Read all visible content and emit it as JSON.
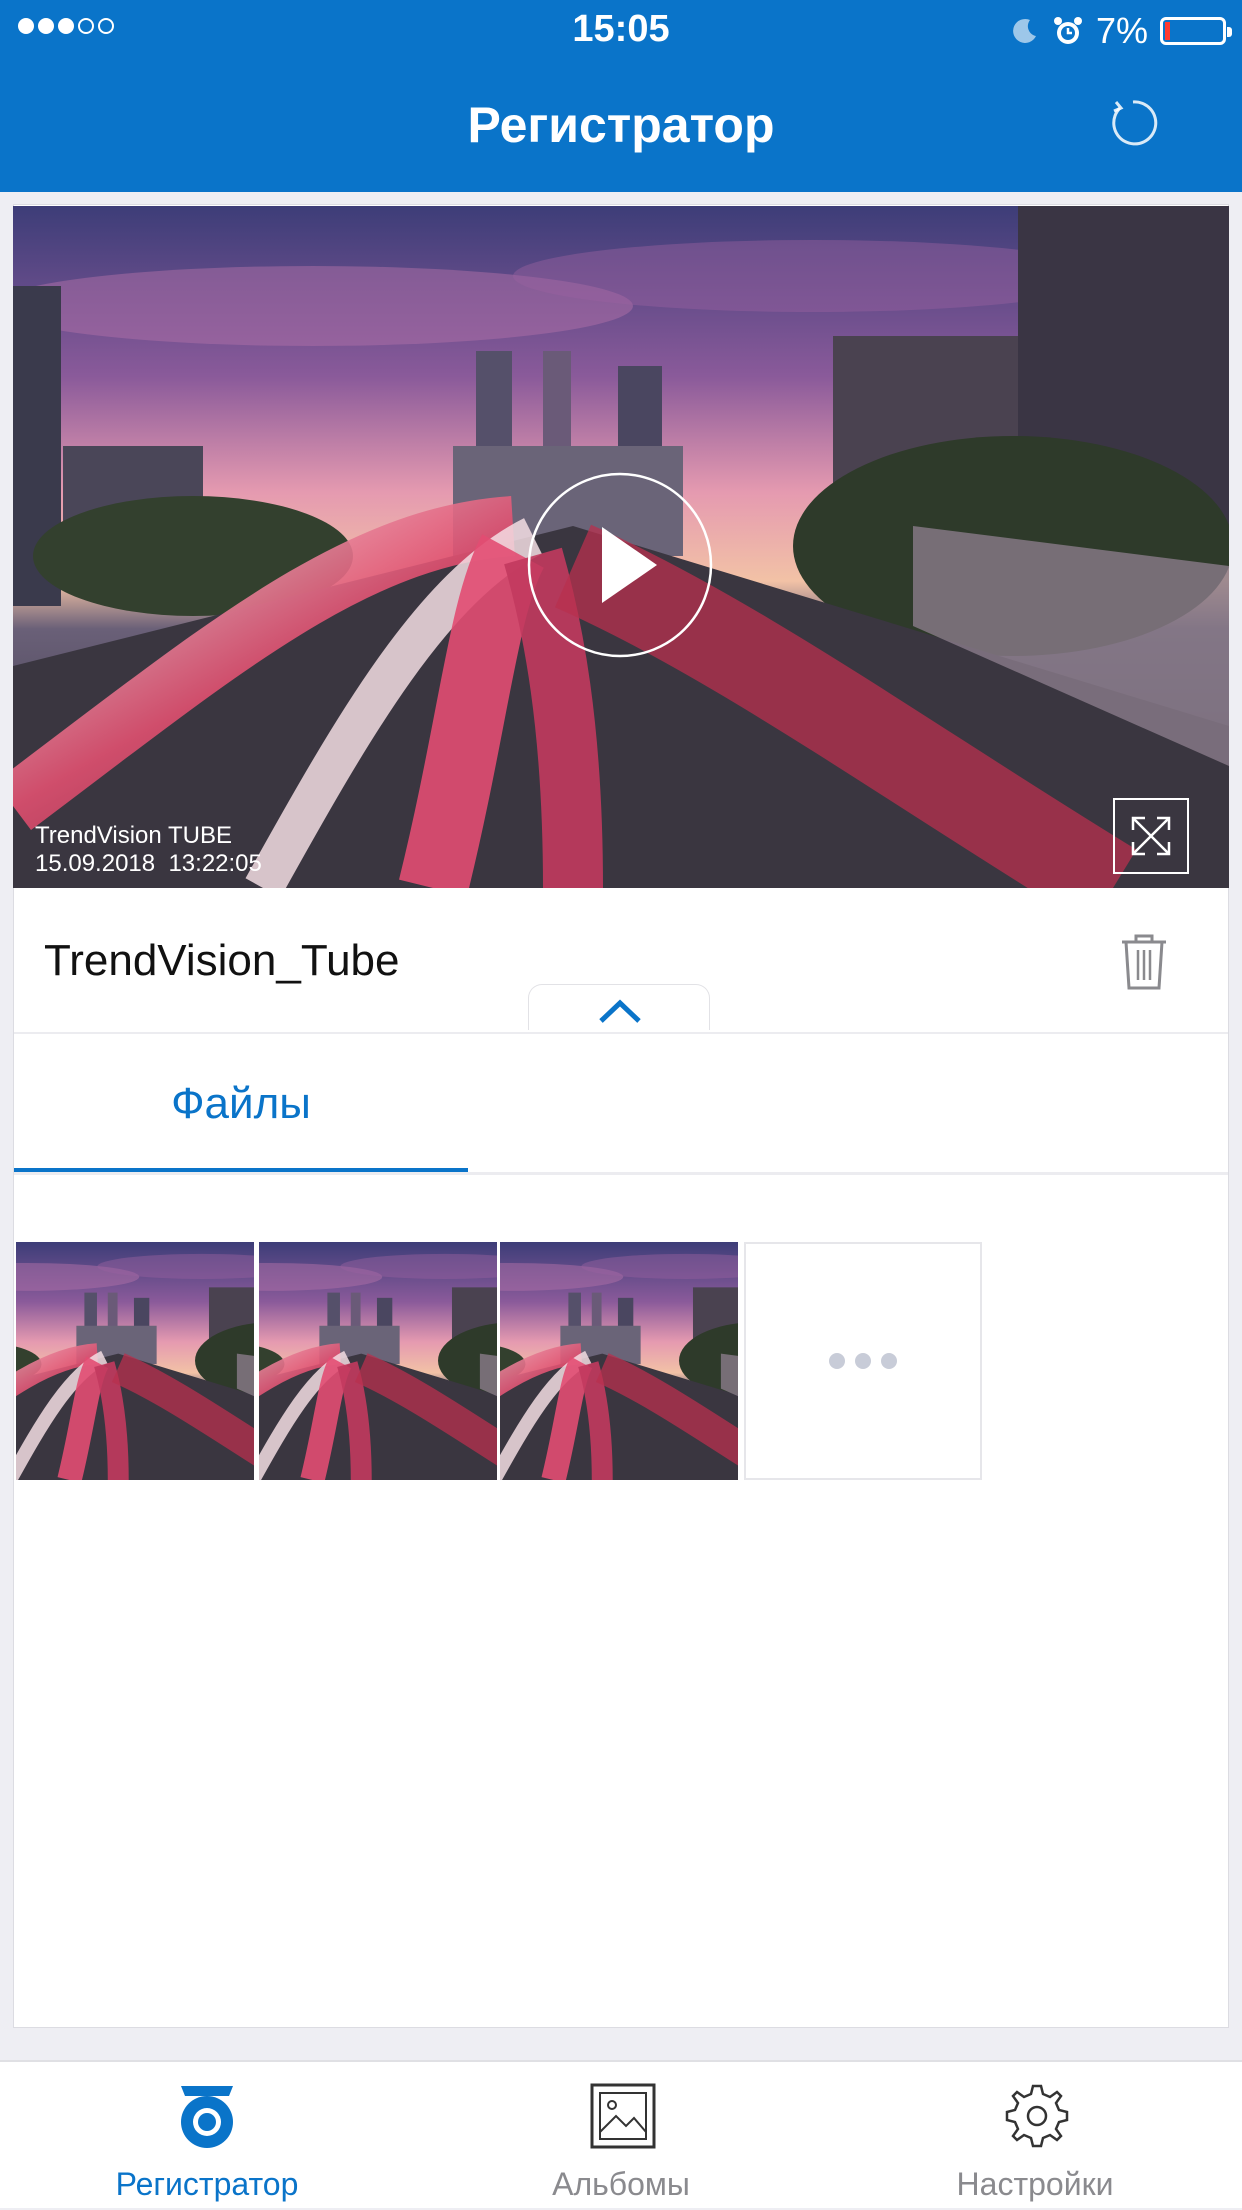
{
  "status_bar": {
    "time": "15:05",
    "battery": "7%",
    "signal_dots": 5,
    "signal_filled": 3
  },
  "header": {
    "title": "Регистратор"
  },
  "player": {
    "overlay_camera": "TrendVision TUBE",
    "overlay_datetime": "15.09.2018  13:22:05"
  },
  "device": {
    "name": "TrendVision_Tube"
  },
  "tabs": [
    {
      "label": "Файлы",
      "active": true
    }
  ],
  "files": {
    "thumbnails": 3,
    "more_tile": true
  },
  "tabbar": {
    "items": [
      {
        "label": "Регистратор",
        "icon": "dashcam-icon",
        "active": true
      },
      {
        "label": "Альбомы",
        "icon": "album-icon",
        "active": false
      },
      {
        "label": "Настройки",
        "icon": "gear-icon",
        "active": false
      }
    ]
  },
  "colors": {
    "accent": "#0a74c9",
    "battery_low": "#ff3b30"
  }
}
